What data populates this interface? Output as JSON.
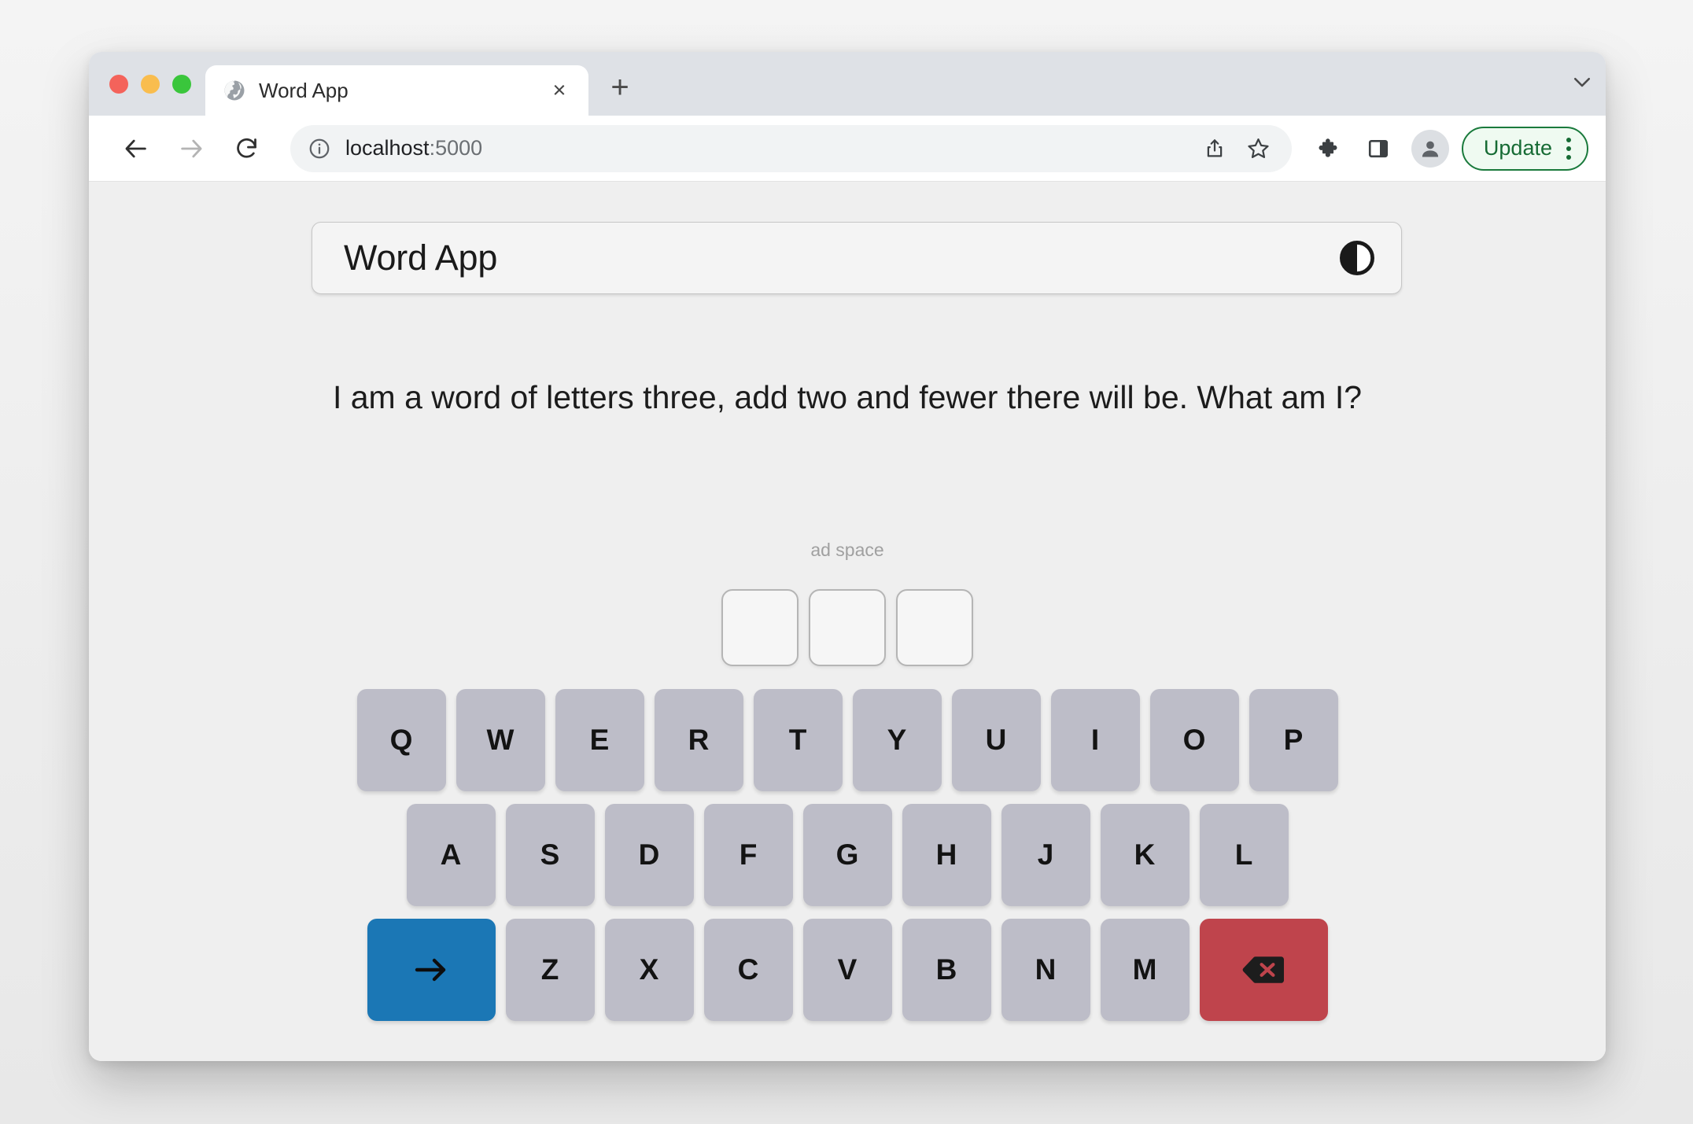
{
  "browser": {
    "traffic_lights": [
      "close",
      "minimize",
      "zoom"
    ],
    "tab": {
      "title": "Word App",
      "favicon": "globe-icon",
      "close_label": "×"
    },
    "new_tab_label": "+",
    "tabstrip_chevron": "chevron-down-icon",
    "toolbar": {
      "back": "back-arrow-icon",
      "forward": "forward-arrow-icon",
      "reload": "reload-icon",
      "site_info": "info-icon",
      "url_host": "localhost",
      "url_port": ":5000",
      "share": "share-icon",
      "bookmark": "star-icon",
      "extensions": "puzzle-icon",
      "side_panel": "side-panel-icon",
      "profile": "avatar-icon",
      "update_label": "Update",
      "overflow": "kebab-menu-icon"
    }
  },
  "app": {
    "header": {
      "title": "Word App",
      "theme_toggle_icon": "contrast-circle-icon"
    },
    "riddle": "I am a word of letters three, add two and fewer there will be. What am I?",
    "ad_space_label": "ad space",
    "answer_tiles": [
      "",
      "",
      ""
    ],
    "keyboard": {
      "row1": [
        "Q",
        "W",
        "E",
        "R",
        "T",
        "Y",
        "U",
        "I",
        "O",
        "P"
      ],
      "row2": [
        "A",
        "S",
        "D",
        "F",
        "G",
        "H",
        "J",
        "K",
        "L"
      ],
      "row3_letters": [
        "Z",
        "X",
        "C",
        "V",
        "B",
        "N",
        "M"
      ],
      "enter_key": {
        "name": "enter-key",
        "icon": "right-arrow-icon"
      },
      "delete_key": {
        "name": "backspace-key",
        "icon": "backspace-icon"
      }
    },
    "colors": {
      "key_face": "#bdbdc8",
      "enter_blue": "#1b77b5",
      "delete_red": "#bf444c",
      "page_background": "#efefef",
      "header_card": "#f4f4f4",
      "update_green": "#166b34"
    }
  }
}
